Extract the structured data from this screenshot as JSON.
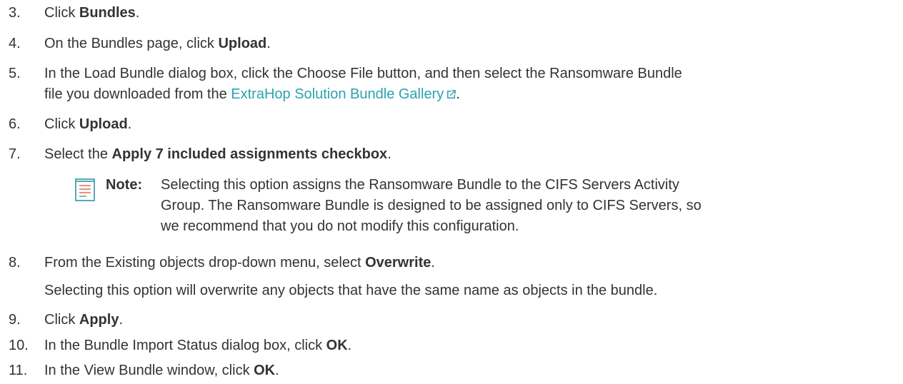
{
  "steps": [
    {
      "num": "3.",
      "prefix": "Click ",
      "bold": "Bundles",
      "suffix": "."
    },
    {
      "num": "4.",
      "prefix": "On the Bundles page, click ",
      "bold": "Upload",
      "suffix": "."
    },
    {
      "num": "5.",
      "line1": "In the Load Bundle dialog box, click the Choose File button, and then select the Ransomware Bundle",
      "line2_prefix": "file you downloaded from the ",
      "link": "ExtraHop Solution Bundle Gallery",
      "line2_suffix": "."
    },
    {
      "num": "6.",
      "prefix": "Click ",
      "bold": "Upload",
      "suffix": "."
    },
    {
      "num": "7.",
      "prefix": "Select the ",
      "bold": "Apply 7 included assignments checkbox",
      "suffix": "."
    },
    {
      "num": "8.",
      "prefix": "From the Existing objects drop-down menu, select ",
      "bold": "Overwrite",
      "suffix": "."
    },
    {
      "num": "9.",
      "prefix": "Click ",
      "bold": "Apply",
      "suffix": "."
    },
    {
      "num": "10.",
      "prefix": "In the Bundle Import Status dialog box, click ",
      "bold": "OK",
      "suffix": "."
    },
    {
      "num": "11.",
      "prefix": "In the View Bundle window, click ",
      "bold": "OK",
      "suffix": "."
    }
  ],
  "note": {
    "label": "Note:",
    "lines": [
      "Selecting this option assigns the Ransomware Bundle to the CIFS Servers Activity",
      "Group. The Ransomware Bundle is designed to be assigned only to CIFS Servers, so",
      "we recommend that you do not modify this configuration."
    ]
  },
  "step8_detail": "Selecting this option will overwrite any objects that have the same name as objects in the bundle.",
  "icons": {
    "note": "note-document-icon",
    "external_link": "external-link-icon"
  },
  "colors": {
    "text": "#333333",
    "link": "#2aa3b1",
    "note_icon_lines": "#e8937a",
    "note_icon_frame": "#5aa9b5"
  }
}
